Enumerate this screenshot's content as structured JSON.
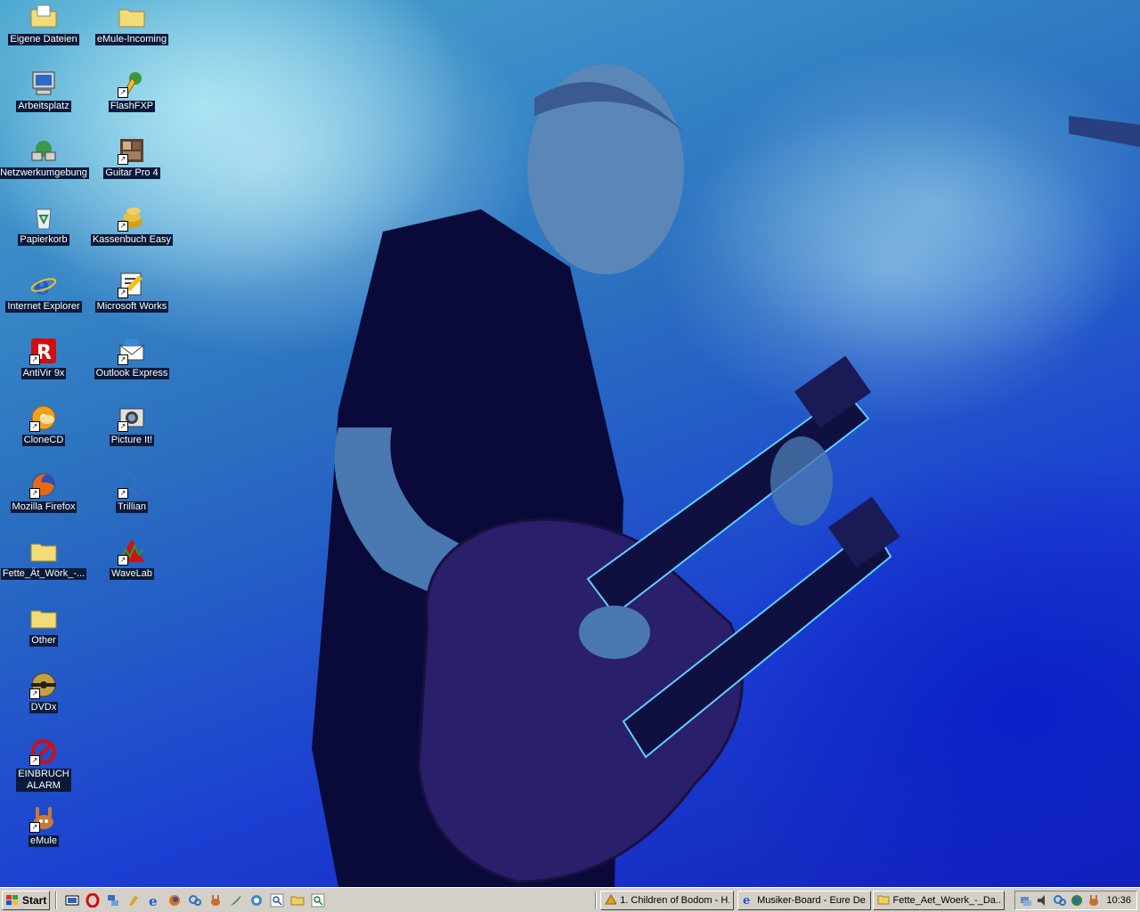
{
  "desktop": {
    "icons": [
      {
        "label": "Eigene Dateien",
        "icon": "my-documents-icon"
      },
      {
        "label": "eMule-Incoming",
        "icon": "folder-icon"
      },
      {
        "label": "Arbeitsplatz",
        "icon": "my-computer-icon"
      },
      {
        "label": "FlashFXP",
        "icon": "flashfxp-icon"
      },
      {
        "label": "Netzwerkumgebung",
        "icon": "network-icon"
      },
      {
        "label": "Guitar Pro 4",
        "icon": "guitar-pro-icon"
      },
      {
        "label": "Papierkorb",
        "icon": "recycle-bin-icon"
      },
      {
        "label": "Kassenbuch Easy",
        "icon": "kassenbuch-icon"
      },
      {
        "label": "Internet Explorer",
        "icon": "internet-explorer-icon"
      },
      {
        "label": "Microsoft Works",
        "icon": "microsoft-works-icon"
      },
      {
        "label": "AntiVir 9x",
        "icon": "antivir-icon"
      },
      {
        "label": "Outlook Express",
        "icon": "outlook-express-icon"
      },
      {
        "label": "CloneCD",
        "icon": "clonecd-icon"
      },
      {
        "label": "Picture It!",
        "icon": "picture-it-icon"
      },
      {
        "label": "Mozilla Firefox",
        "icon": "firefox-icon"
      },
      {
        "label": "Trillian",
        "icon": "trillian-icon"
      },
      {
        "label": "Fette_Ät_Wörk_-...",
        "icon": "folder-icon"
      },
      {
        "label": "WaveLab",
        "icon": "wavelab-icon"
      },
      {
        "label": "Other",
        "icon": "folder-icon"
      },
      {
        "label": "DVDx",
        "icon": "dvdx-icon"
      },
      {
        "label": "EINBRUCH ALARM",
        "icon": "einbruch-alarm-icon"
      },
      {
        "label": "eMule",
        "icon": "emule-icon"
      }
    ]
  },
  "taskbar": {
    "start_label": "Start",
    "tasks": [
      {
        "label": "1. Children of Bodom - H...",
        "icon": "winamp-icon"
      },
      {
        "label": "Musiker-Board - Eure De...",
        "icon": "internet-explorer-icon"
      },
      {
        "label": "Fette_Aet_Woerk_-_Da...",
        "icon": "folder-icon"
      }
    ],
    "clock": "10:36"
  }
}
